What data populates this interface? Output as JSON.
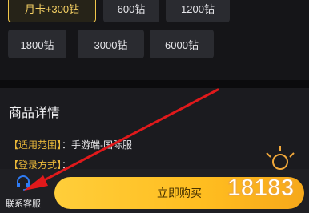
{
  "packages": {
    "row1": [
      {
        "label": "月卡+300钻",
        "selected": true
      },
      {
        "label": "600钻",
        "selected": false
      },
      {
        "label": "1200钻",
        "selected": false
      }
    ],
    "row2": [
      {
        "label": "1800钻"
      },
      {
        "label": "3000钻"
      },
      {
        "label": "6000钻"
      }
    ]
  },
  "details": {
    "title": "商品详情",
    "scope_key": "【适用范围】",
    "scope_value": "：手游端-国际服",
    "login_key": "【登录方式】",
    "login_value": "："
  },
  "bottom": {
    "support_label": "联系客服",
    "buy_label": "立即购买"
  },
  "watermark": {
    "text": "18183"
  },
  "colors": {
    "accent": "#f0c64b",
    "buy_button": "#ffc42a",
    "annotation_arrow": "#e0191b"
  }
}
